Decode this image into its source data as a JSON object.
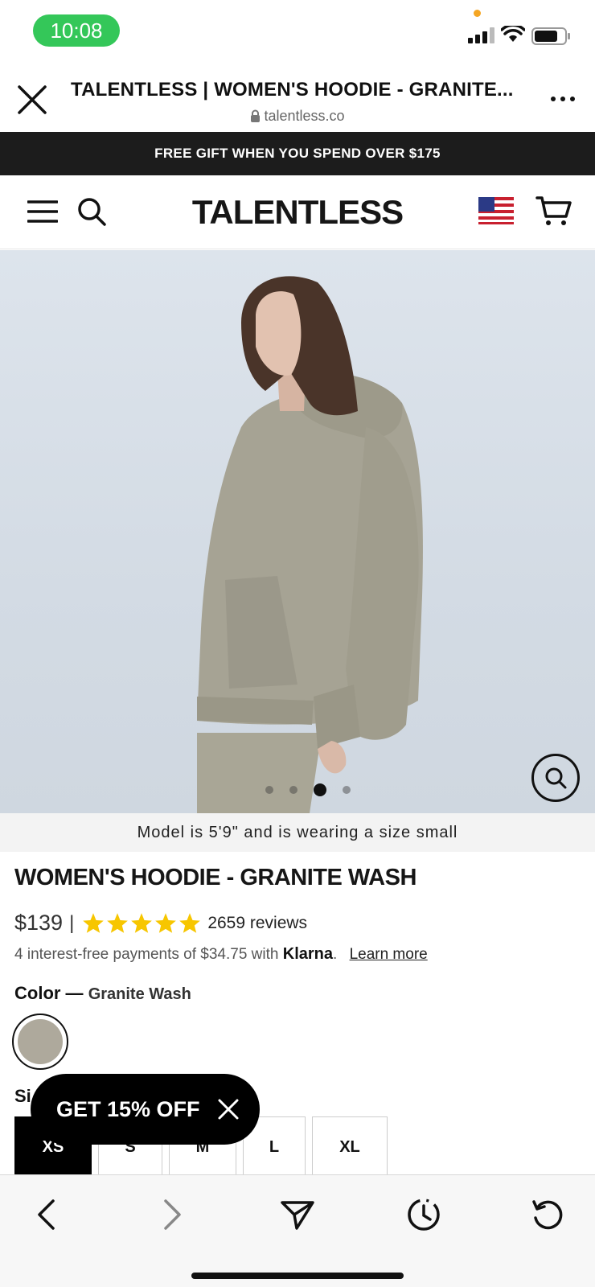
{
  "status_bar": {
    "time": "10:08"
  },
  "browser": {
    "page_title": "TALENTLESS | WOMEN'S HOODIE - GRANITE...",
    "url": "talentless.co"
  },
  "promo_banner": "FREE GIFT WHEN YOU SPEND OVER $175",
  "site": {
    "logo": "TALENTLESS"
  },
  "gallery": {
    "image_count": 4,
    "active_index": 2
  },
  "model_note": "Model is 5'9\" and is wearing a size small",
  "product": {
    "title": "WOMEN'S HOODIE - GRANITE WASH",
    "price": "$139",
    "separator": "|",
    "rating_stars": 5,
    "reviews": "2659 reviews",
    "klarna_text": "4 interest-free payments of $34.75 with",
    "klarna_brand": "Klarna",
    "klarna_period": ".",
    "learn_more": "Learn more",
    "color_label": "Color —",
    "color_value": "Granite Wash",
    "swatch_color": "#aea99c",
    "size_label": "Si",
    "sizes": [
      "XS",
      "S",
      "M",
      "L",
      "XL"
    ],
    "selected_size": "XS"
  },
  "discount_popup": {
    "label": "GET 15% OFF"
  },
  "colors": {
    "status_green": "#34c759",
    "star": "#f7c600",
    "promo_bg": "#1c1c1c"
  }
}
